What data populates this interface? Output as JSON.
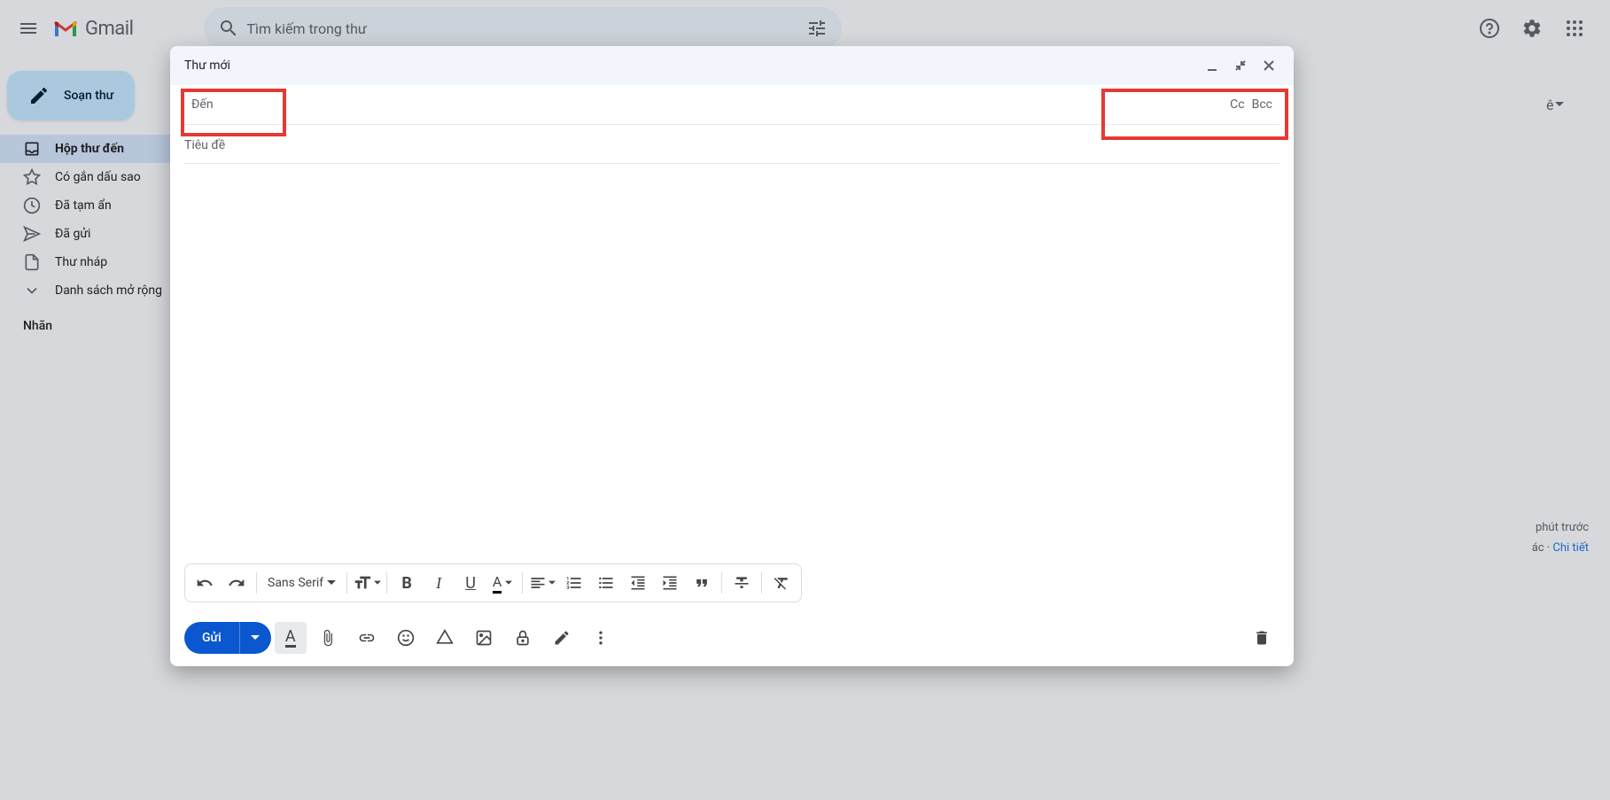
{
  "header": {
    "app_name": "Gmail",
    "search_placeholder": "Tìm kiếm trong thư"
  },
  "sidebar": {
    "compose_label": "Soạn thư",
    "items": [
      {
        "label": "Hộp thư đến",
        "active": true
      },
      {
        "label": "Có gắn dấu sao",
        "active": false
      },
      {
        "label": "Đã tạm ẩn",
        "active": false
      },
      {
        "label": "Đã gửi",
        "active": false
      },
      {
        "label": "Thư nháp",
        "active": false
      },
      {
        "label": "Danh sách mở rộng",
        "active": false
      }
    ],
    "labels_header": "Nhãn"
  },
  "compose": {
    "title": "Thư mới",
    "to_label": "Đến",
    "cc_label": "Cc",
    "bcc_label": "Bcc",
    "subject_placeholder": "Tiêu đề",
    "font_family": "Sans Serif",
    "send_label": "Gửi"
  },
  "right_panel": {
    "line1": "phút trước",
    "line2_prefix": "ác · ",
    "line2_link": "Chi tiết"
  },
  "input_method": {
    "glyph": "ê"
  }
}
